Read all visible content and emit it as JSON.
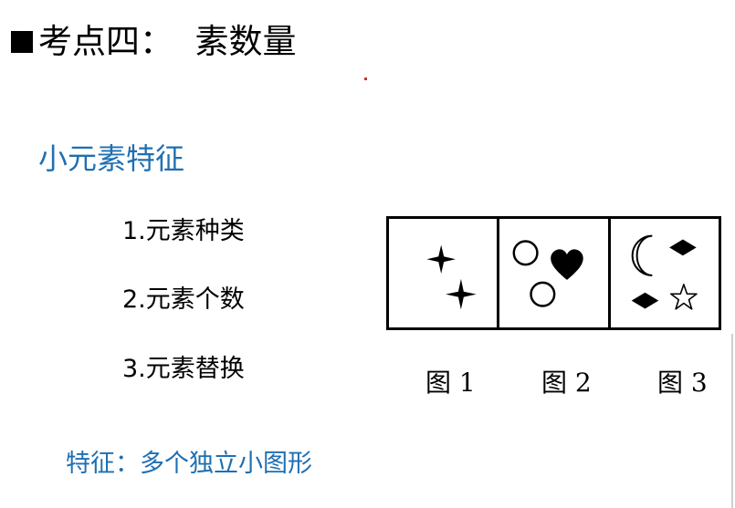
{
  "title": {
    "text": "考点四：  素数量"
  },
  "subtitle": "小元素特征",
  "items": [
    "1.元素种类",
    "2.元素个数",
    "3.元素替换"
  ],
  "feature": "特征：多个独立小图形",
  "figures": {
    "labels": [
      "图 1",
      "图 2",
      "图 3"
    ],
    "panels": [
      {
        "icons": [
          "four-point-star",
          "four-point-star"
        ]
      },
      {
        "icons": [
          "circle",
          "heart",
          "circle"
        ]
      },
      {
        "icons": [
          "crescent-moon",
          "diamond",
          "diamond",
          "five-point-star"
        ]
      }
    ]
  },
  "colors": {
    "accent_blue": "#1f6fb2",
    "text": "#000000"
  }
}
